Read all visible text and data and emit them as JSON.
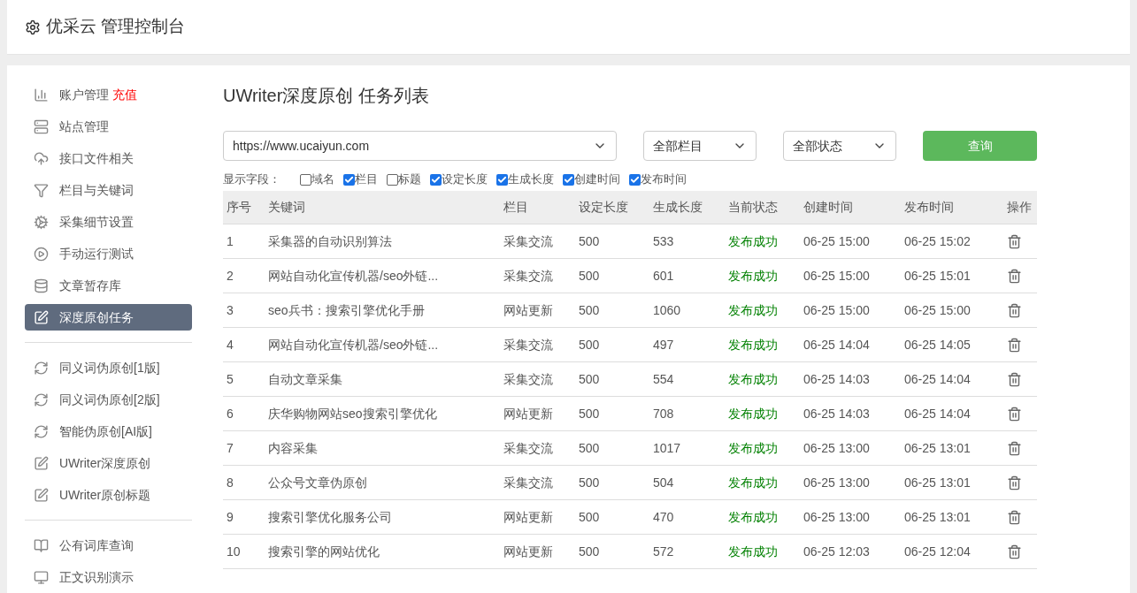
{
  "header": {
    "title": "优采云 管理控制台"
  },
  "sidebar": {
    "groups": [
      [
        {
          "label": "账户管理",
          "badge": "充值",
          "selected": false
        },
        {
          "label": "站点管理",
          "selected": false
        },
        {
          "label": "接口文件相关",
          "selected": false
        },
        {
          "label": "栏目与关键词",
          "selected": false
        },
        {
          "label": "采集细节设置",
          "selected": false
        },
        {
          "label": "手动运行测试",
          "selected": false
        },
        {
          "label": "文章暂存库",
          "selected": false
        },
        {
          "label": "深度原创任务",
          "selected": true
        }
      ],
      [
        {
          "label": "同义词伪原创[1版]",
          "selected": false
        },
        {
          "label": "同义词伪原创[2版]",
          "selected": false
        },
        {
          "label": "智能伪原创[AI版]",
          "selected": false
        },
        {
          "label": "UWriter深度原创",
          "selected": false
        },
        {
          "label": "UWriter原创标题",
          "selected": false
        }
      ],
      [
        {
          "label": "公有词库查询",
          "selected": false
        },
        {
          "label": "正文识别演示",
          "selected": false
        }
      ]
    ]
  },
  "main": {
    "title": "UWriter深度原创 任务列表",
    "filters": {
      "site": "https://www.ucaiyun.com",
      "column": "全部栏目",
      "status": "全部状态",
      "button": "查询"
    },
    "fields_label": "显示字段：",
    "fields": [
      {
        "label": "域名",
        "checked": false
      },
      {
        "label": "栏目",
        "checked": true
      },
      {
        "label": "标题",
        "checked": false
      },
      {
        "label": "设定长度",
        "checked": true
      },
      {
        "label": "生成长度",
        "checked": true
      },
      {
        "label": "创建时间",
        "checked": true
      },
      {
        "label": "发布时间",
        "checked": true
      }
    ],
    "table": {
      "columns": [
        "序号",
        "关键词",
        "栏目",
        "设定长度",
        "生成长度",
        "当前状态",
        "创建时间",
        "发布时间",
        "操作"
      ],
      "rows": [
        [
          "1",
          "采集器的自动识别算法",
          "采集交流",
          "500",
          "533",
          "发布成功",
          "06-25 15:00",
          "06-25 15:02"
        ],
        [
          "2",
          "网站自动化宣传机器/seo外链...",
          "采集交流",
          "500",
          "601",
          "发布成功",
          "06-25 15:00",
          "06-25 15:01"
        ],
        [
          "3",
          "seo兵书：搜索引擎优化手册",
          "网站更新",
          "500",
          "1060",
          "发布成功",
          "06-25 15:00",
          "06-25 15:00"
        ],
        [
          "4",
          "网站自动化宣传机器/seo外链...",
          "采集交流",
          "500",
          "497",
          "发布成功",
          "06-25 14:04",
          "06-25 14:05"
        ],
        [
          "5",
          "自动文章采集",
          "采集交流",
          "500",
          "554",
          "发布成功",
          "06-25 14:03",
          "06-25 14:04"
        ],
        [
          "6",
          "庆华购物网站seo搜索引擎优化",
          "网站更新",
          "500",
          "708",
          "发布成功",
          "06-25 14:03",
          "06-25 14:04"
        ],
        [
          "7",
          "内容采集",
          "采集交流",
          "500",
          "1017",
          "发布成功",
          "06-25 13:00",
          "06-25 13:01"
        ],
        [
          "8",
          "公众号文章伪原创",
          "采集交流",
          "500",
          "504",
          "发布成功",
          "06-25 13:00",
          "06-25 13:01"
        ],
        [
          "9",
          "搜索引擎优化服务公司",
          "网站更新",
          "500",
          "470",
          "发布成功",
          "06-25 13:00",
          "06-25 13:01"
        ],
        [
          "10",
          "搜索引擎的网站优化",
          "网站更新",
          "500",
          "572",
          "发布成功",
          "06-25 12:03",
          "06-25 12:04"
        ]
      ]
    }
  }
}
